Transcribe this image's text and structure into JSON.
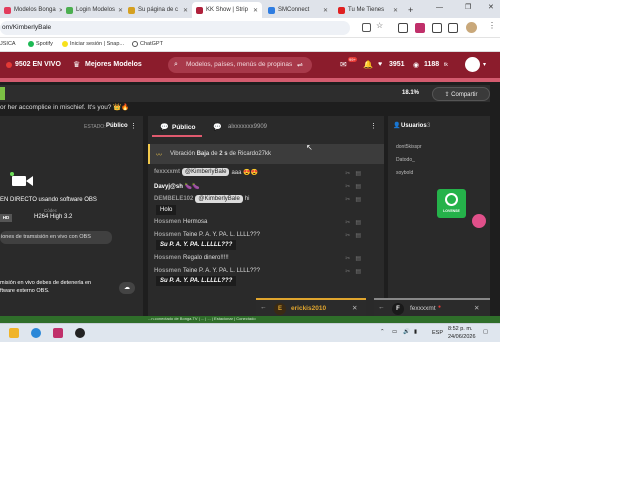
{
  "browser": {
    "tabs": [
      {
        "label": "Modelos Bonga",
        "color": "#e23c5c"
      },
      {
        "label": "Login Modelos",
        "color": "#4caf50"
      },
      {
        "label": "Su página de c",
        "color": "#d5a020"
      },
      {
        "label": "KK Show | Strip",
        "color": "#b0213c"
      },
      {
        "label": "SMConnect",
        "color": "#2f7de1"
      },
      {
        "label": "Tu Me Tienes",
        "color": "#e02020"
      }
    ],
    "new_tab_label": "+",
    "url": "om/KimberlyBale",
    "bookmarks": [
      "JSICA",
      "Spotify",
      "Iniciar sesión | Snap...",
      "ChatGPT"
    ]
  },
  "site": {
    "live_count": "9502 EN VIVO",
    "best_models": "Mejores Modelos",
    "search_placeholder": "Modelos, países, menús de propinas",
    "notif_count": "99+",
    "likes": "3951",
    "tokens": "1188",
    "tokens_suffix": "tk"
  },
  "goal": {
    "percent_label": "18.1%",
    "percent_value": 18.1,
    "share_label": "Compartir",
    "tip_text": "or her accomplice in mischief. It's you? 👑🔥"
  },
  "broadcast": {
    "estado_label": "ESTADO:",
    "estado_value": "Público",
    "direct_label": "EN DIRECTO usando software OBS",
    "codec_label": "Códec",
    "codec_value": "H264 High 3.2",
    "hd_badge": "HD",
    "obs_button": "iones de tramsisión en vivo con OBS",
    "note_line1": "misión en vivo debes de detenerla en",
    "note_line2": "ftware externo OBS."
  },
  "chat": {
    "tab_public": "Público",
    "tab_private": "alxxxxxxx9909",
    "vibration_prefix": "Vibración",
    "vibration_level": "Baja",
    "vibration_mid": "de",
    "vibration_secs": "2 s",
    "vibration_from": "de Ricardo27kk",
    "messages": [
      {
        "user": "fexxxxmt",
        "mention": "@KimberlyBale",
        "text": "aaa 😍😍"
      },
      {
        "user": "Davyj@sh",
        "mention": "",
        "text": "🍆🍆"
      },
      {
        "user": "DEMBELE102",
        "mention": "@KimberlyBale",
        "text": "hi"
      },
      {
        "user": "",
        "mention": "",
        "text": "Holo"
      },
      {
        "user": "Hossmen",
        "mention": "",
        "text": "Hermosa"
      },
      {
        "user": "Hossmen",
        "mention": "",
        "text": "Teine P. A. Y. PA. L. LLLL???"
      },
      {
        "user": "",
        "mention": "",
        "text": "Su P. A. Y. PA. L.LLLL???"
      },
      {
        "user": "Hossmen",
        "mention": "",
        "text": "Regalo dinero!!!!!"
      },
      {
        "user": "Hossmen",
        "mention": "",
        "text": "Teine P. A. Y. PA. L. LLLL???"
      },
      {
        "user": "",
        "mention": "",
        "text": "Su P. A. Y. PA. L.LLLL???"
      }
    ]
  },
  "users": {
    "title": "Usuarios",
    "count": "3",
    "list": [
      "dont5kisspr",
      "Datodo_",
      "soybold"
    ],
    "lovense_label": "LOVENSE"
  },
  "dms": [
    {
      "initial": "E",
      "name": "erickis2010",
      "color": "#e0a52e"
    },
    {
      "initial": "F",
      "name": "fexxxxmt",
      "color": "#8a8a8a"
    }
  ],
  "statusbar_text": "...n.conectado de Bonga.TV | ... | ... | Estacionar | Conectado",
  "taskbar": {
    "lang": "ESP",
    "time": "8:52 p. m.",
    "date": "24/06/2026"
  }
}
